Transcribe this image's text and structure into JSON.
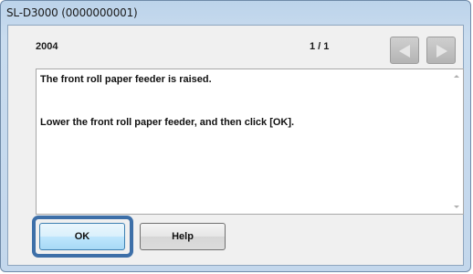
{
  "window": {
    "title": "SL-D3000 (0000000001)"
  },
  "header": {
    "code": "2004",
    "page_indicator": "1 / 1",
    "prev_icon": "left-triangle-icon",
    "next_icon": "right-triangle-icon"
  },
  "message": {
    "line1": "The front roll paper feeder is raised.",
    "line2": "Lower the front roll paper feeder, and then click [OK]."
  },
  "buttons": {
    "ok_label": "OK",
    "help_label": "Help"
  },
  "colors": {
    "focus_ring": "#3d6fa8",
    "title_bg": "#c3d7ec",
    "panel_bg": "#f0f0f0"
  }
}
